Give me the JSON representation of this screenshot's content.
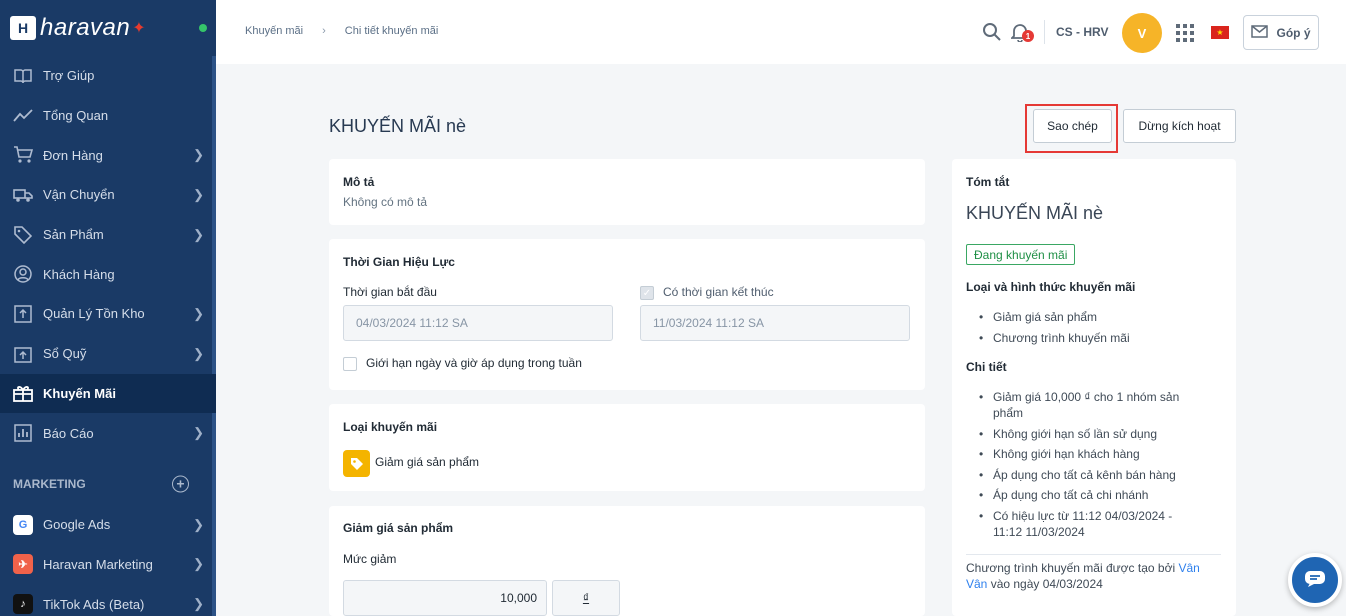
{
  "sidebar": {
    "brand": "haravan",
    "items": [
      {
        "label": "Trợ Giúp",
        "icon": "book-icon",
        "chevron": false
      },
      {
        "label": "Tổng Quan",
        "icon": "trend-icon",
        "chevron": false
      },
      {
        "label": "Đơn Hàng",
        "icon": "cart-icon",
        "chevron": true
      },
      {
        "label": "Vận Chuyển",
        "icon": "truck-icon",
        "chevron": true
      },
      {
        "label": "Sản Phẩm",
        "icon": "tag-icon",
        "chevron": true
      },
      {
        "label": "Khách Hàng",
        "icon": "user-icon",
        "chevron": false
      },
      {
        "label": "Quản Lý Tồn Kho",
        "icon": "inventory-icon",
        "chevron": true
      },
      {
        "label": "Sổ Quỹ",
        "icon": "cashbook-icon",
        "chevron": true
      },
      {
        "label": "Khuyến Mãi",
        "icon": "gift-icon",
        "chevron": false,
        "active": true
      },
      {
        "label": "Báo Cáo",
        "icon": "report-icon",
        "chevron": true
      }
    ],
    "marketing_label": "MARKETING",
    "apps": [
      {
        "label": "Google Ads",
        "icon": "google-icon"
      },
      {
        "label": "Haravan Marketing",
        "icon": "haravan-marketing-icon"
      },
      {
        "label": "TikTok Ads (Beta)",
        "icon": "tiktok-icon"
      }
    ]
  },
  "topbar": {
    "breadcrumb": [
      "Khuyến mãi",
      "Chi tiết khuyến mãi"
    ],
    "breadcrumb_sep": "›",
    "notification_count": "1",
    "store_name": "CS - HRV",
    "avatar_initial": "V",
    "feedback_label": "Góp ý"
  },
  "page": {
    "title": "KHUYẾN MÃI nè",
    "copy_button": "Sao chép",
    "deactivate_button": "Dừng kích hoạt"
  },
  "description": {
    "title": "Mô tả",
    "value": "Không có mô tả"
  },
  "validity": {
    "title": "Thời Gian Hiệu Lực",
    "start_label": "Thời gian bắt đầu",
    "start_value": "04/03/2024 11:12 SA",
    "end_label": "Có thời gian kết thúc",
    "end_value": "11/03/2024 11:12 SA",
    "weekday_limit_label": "Giới hạn ngày và giờ áp dụng trong tuần"
  },
  "promo_type": {
    "title": "Loại khuyến mãi",
    "value": "Giảm giá sản phẩm"
  },
  "discount": {
    "title": "Giảm giá sản phẩm",
    "amount_label": "Mức giảm",
    "amount_value": "10,000",
    "currency": "₫"
  },
  "summary": {
    "title": "Tóm tắt",
    "name": "KHUYẾN MÃI nè",
    "status": "Đang khuyến mãi",
    "type_heading": "Loại và hình thức khuyến mãi",
    "type_items": [
      "Giảm giá sản phẩm",
      "Chương trình khuyến mãi"
    ],
    "detail_heading": "Chi tiết",
    "detail_items": [
      "Giảm giá 10,000 ₫ cho 1 nhóm sản phẩm",
      "Không giới hạn số lần sử dụng",
      "Không giới hạn khách hàng",
      "Áp dụng cho tất cả kênh bán hàng",
      "Áp dụng cho tất cả chi nhánh",
      "Có hiệu lực từ 11:12 04/03/2024 - 11:12 11/03/2024"
    ],
    "created_prefix": "Chương trình khuyến mãi được tạo bởi",
    "created_by": "Vân Vân",
    "created_suffix": "vào ngày 04/03/2024"
  },
  "colors": {
    "sidebar_bg": "#1a3a66",
    "avatar_bg": "#f6b428",
    "status_green": "#3aa763",
    "highlight_red": "#e53935",
    "chat_blue": "#1f65b3"
  }
}
